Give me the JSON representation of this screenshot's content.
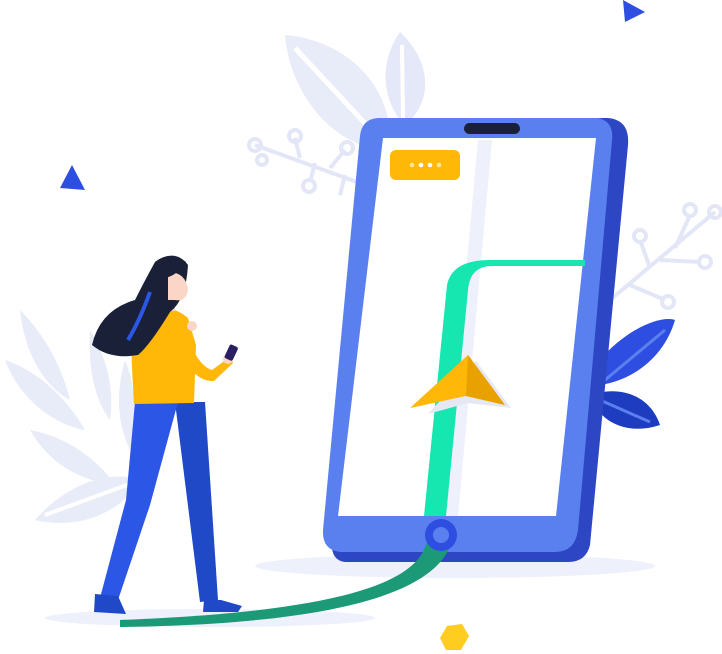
{
  "illustration": {
    "subject": "woman-navigating-with-phone",
    "colors": {
      "phone_body": "#2d47c4",
      "phone_face": "#5a80ef",
      "screen": "#ffffff",
      "route": "#16e6b0",
      "route_path_ground": "#1c9a77",
      "nav_arrow": "#ffb808",
      "status_pill": "#ffb808",
      "leaves_light": "#e8ebf8",
      "leaves_dark": "#2d4ee0",
      "skin": "#fbd5c6",
      "hair": "#1a2038",
      "shirt": "#ffb808",
      "pants": "#2b56e6"
    },
    "icons": [
      "map-pin-arrow-icon",
      "status-dots-icon",
      "home-button-icon",
      "triangle-deco-icon",
      "hexagon-deco-icon",
      "leaf-icon"
    ]
  }
}
